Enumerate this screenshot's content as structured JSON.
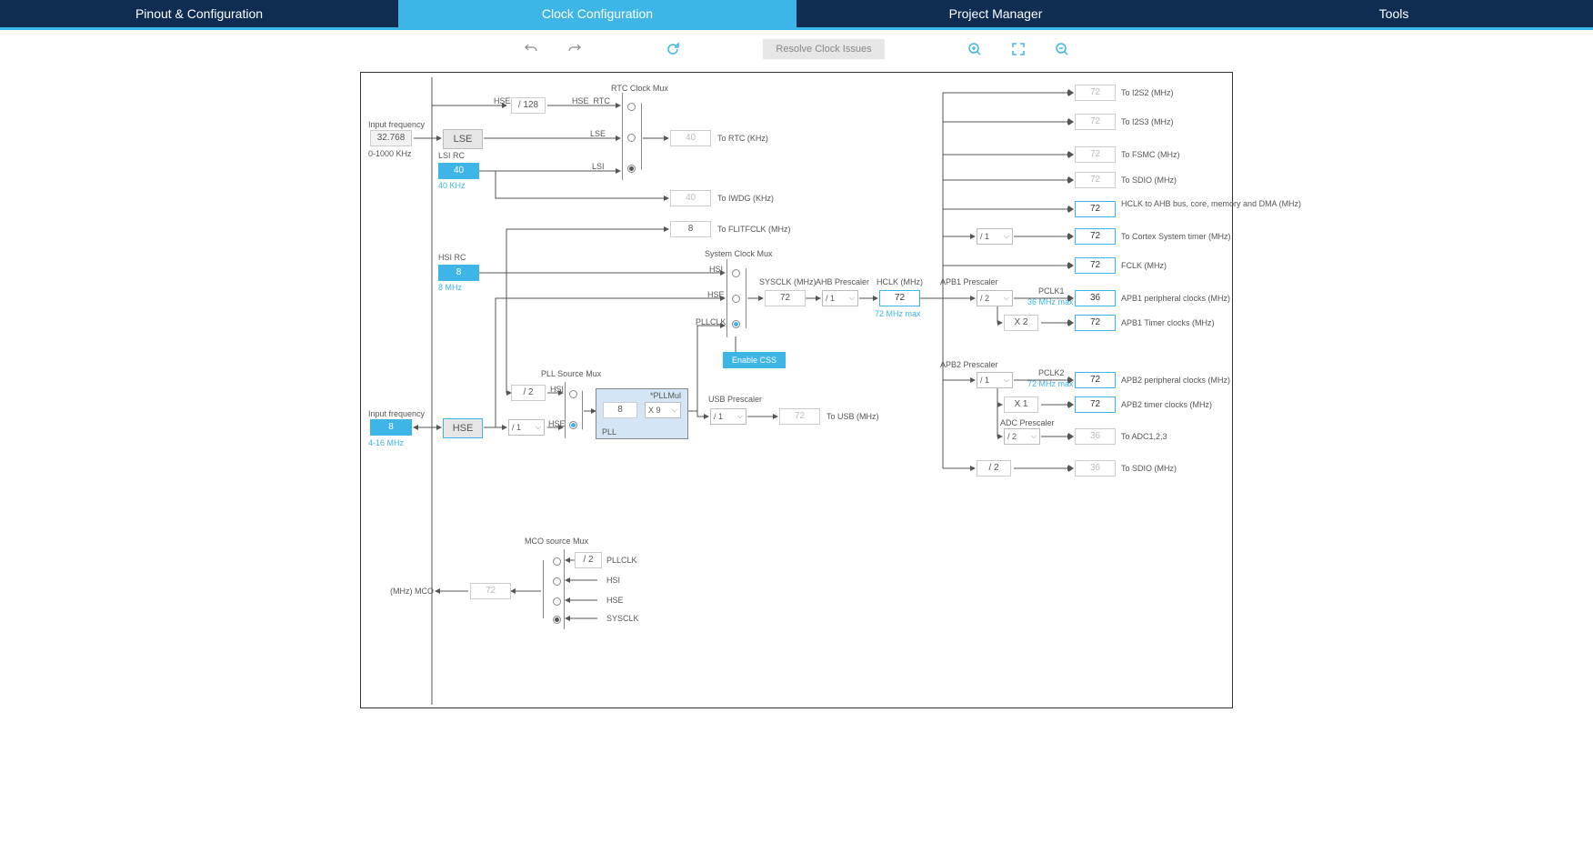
{
  "tabs": {
    "pinout": "Pinout & Configuration",
    "clock": "Clock Configuration",
    "project": "Project Manager",
    "tools": "Tools"
  },
  "toolbar": {
    "resolve": "Resolve Clock Issues"
  },
  "inputs": {
    "lse_freq_label": "Input frequency",
    "lse_freq_val": "32.768",
    "lse_freq_range": "0-1000 KHz",
    "hse_freq_label": "Input frequency",
    "hse_freq_val": "8",
    "hse_freq_range": "4-16 MHz"
  },
  "sources": {
    "lse": "LSE",
    "lsi_rc": "LSI RC",
    "lsi_val": "40",
    "lsi_khz": "40 KHz",
    "hsi_rc": "HSI RC",
    "hsi_val": "8",
    "hsi_mhz": "8 MHz",
    "hse": "HSE"
  },
  "rtc": {
    "title": "RTC Clock Mux",
    "hse_label": "HSE",
    "div128": "/ 128",
    "hse_rtc": "HSE_RTC",
    "lse_label": "LSE",
    "lsi_label": "LSI",
    "rtc_val": "40",
    "rtc_out": "To RTC (KHz)",
    "iwdg_val": "40",
    "iwdg_out": "To IWDG (KHz)"
  },
  "flitf": {
    "val": "8",
    "out": "To FLITFCLK (MHz)"
  },
  "sysmux": {
    "title": "System Clock Mux",
    "hsi": "HSI",
    "hse": "HSE",
    "pllclk": "PLLCLK",
    "enable_css": "Enable CSS"
  },
  "pll": {
    "src_title": "PLL Source Mux",
    "hsi": "HSI",
    "hse": "HSE",
    "div2": "/ 2",
    "hse_div": "/ 1",
    "label": "PLL",
    "mul_val": "8",
    "mul_label": "*PLLMul",
    "mul_sel": "X 9"
  },
  "usb": {
    "title": "USB Prescaler",
    "div": "/ 1",
    "val": "72",
    "out": "To USB (MHz)"
  },
  "sysclk": {
    "label": "SYSCLK (MHz)",
    "val": "72"
  },
  "ahb": {
    "title": "AHB Prescaler",
    "div": "/ 1"
  },
  "hclk": {
    "label": "HCLK (MHz)",
    "val": "72",
    "max": "72 MHz max"
  },
  "apb1": {
    "title": "APB1 Prescaler",
    "div": "/ 2",
    "pclk_label": "PCLK1",
    "pclk_max": "36 MHz max",
    "tim_mul": "X 2"
  },
  "apb2": {
    "title": "APB2 Prescaler",
    "div": "/ 1",
    "pclk_label": "PCLK2",
    "pclk_max": "72 MHz max",
    "tim_mul": "X 1"
  },
  "adc": {
    "title": "ADC Prescaler",
    "div": "/ 2"
  },
  "cortex_div": "/ 1",
  "sdio_div": "/ 2",
  "outputs": {
    "i2s2": {
      "val": "72",
      "label": "To I2S2 (MHz)"
    },
    "i2s3": {
      "val": "72",
      "label": "To I2S3 (MHz)"
    },
    "fsmc": {
      "val": "72",
      "label": "To FSMC (MHz)"
    },
    "sdio1": {
      "val": "72",
      "label": "To SDIO (MHz)"
    },
    "hclk_ahb": {
      "val": "72",
      "label": "HCLK to AHB bus, core, memory and DMA (MHz)"
    },
    "cortex": {
      "val": "72",
      "label": "To Cortex System timer (MHz)"
    },
    "fclk": {
      "val": "72",
      "label": "FCLK (MHz)"
    },
    "apb1_periph": {
      "val": "36",
      "label": "APB1 peripheral clocks (MHz)"
    },
    "apb1_tim": {
      "val": "72",
      "label": "APB1 Timer clocks (MHz)"
    },
    "apb2_periph": {
      "val": "72",
      "label": "APB2 peripheral clocks (MHz)"
    },
    "apb2_tim": {
      "val": "72",
      "label": "APB2 timer clocks (MHz)"
    },
    "adc": {
      "val": "36",
      "label": "To ADC1,2,3"
    },
    "sdio2": {
      "val": "36",
      "label": "To SDIO (MHz)"
    }
  },
  "mco": {
    "title": "MCO source Mux",
    "div2": "/ 2",
    "pllclk": "PLLCLK",
    "hsi": "HSI",
    "hse": "HSE",
    "sysclk": "SYSCLK",
    "val": "72",
    "label": "(MHz) MCO"
  }
}
